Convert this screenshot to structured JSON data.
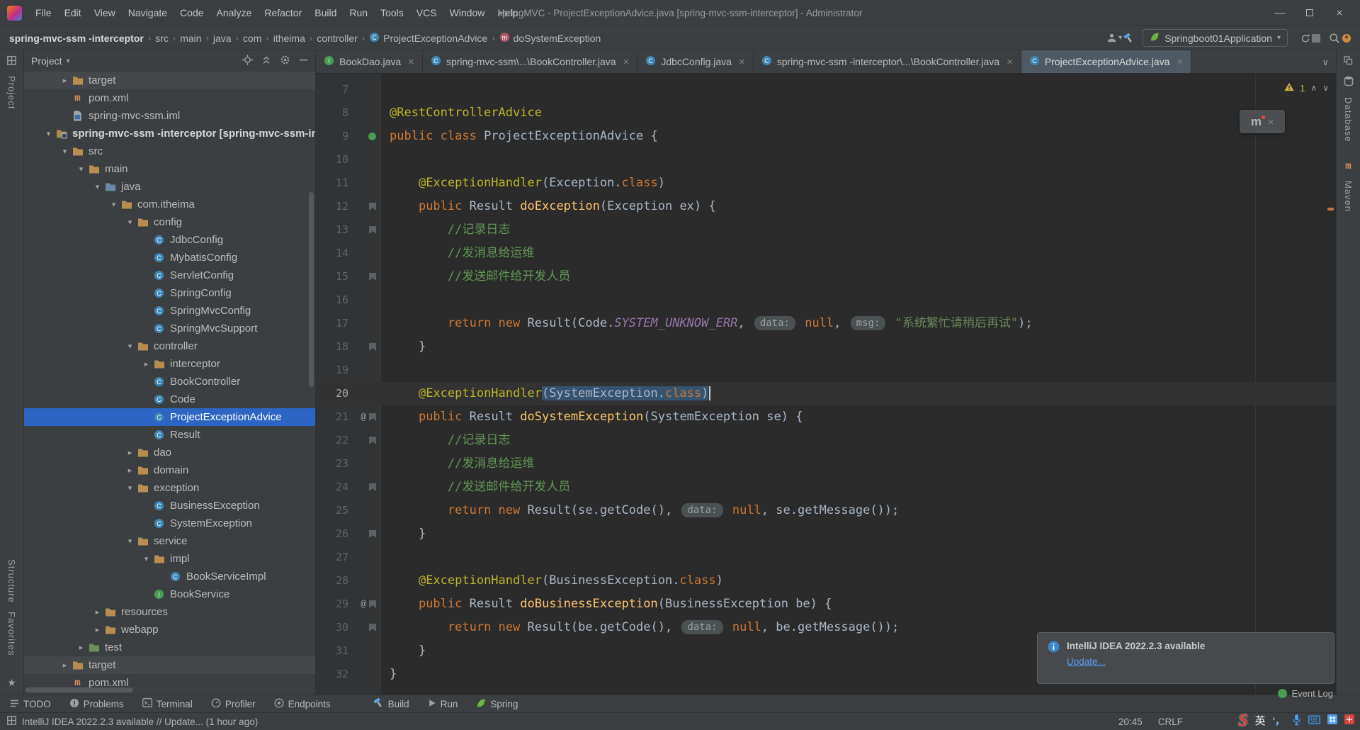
{
  "window": {
    "title": "springMVC - ProjectExceptionAdvice.java [spring-mvc-ssm-interceptor] - Administrator",
    "menus": [
      "File",
      "Edit",
      "View",
      "Navigate",
      "Code",
      "Analyze",
      "Refactor",
      "Build",
      "Run",
      "Tools",
      "VCS",
      "Window",
      "Help"
    ],
    "controls": {
      "minimize": "—",
      "close": "×"
    }
  },
  "navbar": {
    "breadcrumbs": [
      {
        "label": "spring-mvc-ssm -interceptor"
      },
      {
        "label": "src"
      },
      {
        "label": "main"
      },
      {
        "label": "java"
      },
      {
        "label": "com"
      },
      {
        "label": "itheima"
      },
      {
        "label": "controller"
      },
      {
        "label": "ProjectExceptionAdvice",
        "icon": "class"
      },
      {
        "label": "doSystemException",
        "icon": "method"
      }
    ],
    "right": {
      "icons_before": [
        "collaborate",
        "hammer"
      ],
      "run_config": "Springboot01Application",
      "icons_after": [
        "run",
        "debug",
        "coverage",
        "restart",
        "stop"
      ],
      "icons_tail": [
        "search",
        "update"
      ]
    }
  },
  "left_stripe": {
    "top": [
      "Project"
    ],
    "bottom": [
      "Structure",
      "Favorites"
    ]
  },
  "right_stripe": {
    "items": [
      "Database",
      "Maven"
    ]
  },
  "project_panel": {
    "title": "Project",
    "header_icons": [
      "locate",
      "collapse",
      "gear",
      "minus"
    ],
    "tree": [
      {
        "l": "target",
        "d": 1,
        "i": "folder",
        "a": "c",
        "band": true
      },
      {
        "l": "pom.xml",
        "d": 1,
        "i": "mvn"
      },
      {
        "l": "spring-mvc-ssm.iml",
        "d": 1,
        "i": "iml"
      },
      {
        "l": "spring-mvc-ssm -interceptor [spring-mvc-ssm-int...",
        "d": 0,
        "i": "mod",
        "a": "e",
        "bold": true
      },
      {
        "l": "src",
        "d": 1,
        "i": "folder",
        "a": "e"
      },
      {
        "l": "main",
        "d": 2,
        "i": "folder",
        "a": "e"
      },
      {
        "l": "java",
        "d": 3,
        "i": "folderBlue",
        "a": "e"
      },
      {
        "l": "com.itheima",
        "d": 4,
        "i": "pkg",
        "a": "e"
      },
      {
        "l": "config",
        "d": 5,
        "i": "pkg",
        "a": "e"
      },
      {
        "l": "JdbcConfig",
        "d": 6,
        "i": "cls"
      },
      {
        "l": "MybatisConfig",
        "d": 6,
        "i": "cls"
      },
      {
        "l": "ServletConfig",
        "d": 6,
        "i": "cls"
      },
      {
        "l": "SpringConfig",
        "d": 6,
        "i": "cls"
      },
      {
        "l": "SpringMvcConfig",
        "d": 6,
        "i": "cls"
      },
      {
        "l": "SpringMvcSupport",
        "d": 6,
        "i": "cls"
      },
      {
        "l": "controller",
        "d": 5,
        "i": "pkg",
        "a": "e"
      },
      {
        "l": "interceptor",
        "d": 6,
        "i": "pkg",
        "a": "c"
      },
      {
        "l": "BookController",
        "d": 6,
        "i": "cls"
      },
      {
        "l": "Code",
        "d": 6,
        "i": "cls"
      },
      {
        "l": "ProjectExceptionAdvice",
        "d": 6,
        "i": "cls",
        "sel": true
      },
      {
        "l": "Result",
        "d": 6,
        "i": "cls"
      },
      {
        "l": "dao",
        "d": 5,
        "i": "pkg",
        "a": "c"
      },
      {
        "l": "domain",
        "d": 5,
        "i": "pkg",
        "a": "c"
      },
      {
        "l": "exception",
        "d": 5,
        "i": "pkg",
        "a": "e"
      },
      {
        "l": "BusinessException",
        "d": 6,
        "i": "cls"
      },
      {
        "l": "SystemException",
        "d": 6,
        "i": "cls"
      },
      {
        "l": "service",
        "d": 5,
        "i": "pkg",
        "a": "e"
      },
      {
        "l": "impl",
        "d": 6,
        "i": "pkg",
        "a": "e"
      },
      {
        "l": "BookServiceImpl",
        "d": 7,
        "i": "cls"
      },
      {
        "l": "BookService",
        "d": 6,
        "i": "itf"
      },
      {
        "l": "resources",
        "d": 3,
        "i": "folder",
        "a": "c"
      },
      {
        "l": "webapp",
        "d": 3,
        "i": "folder",
        "a": "c"
      },
      {
        "l": "test",
        "d": 2,
        "i": "folderGreen",
        "a": "c"
      },
      {
        "l": "target",
        "d": 1,
        "i": "folder",
        "a": "c",
        "band": true
      },
      {
        "l": "pom.xml",
        "d": 1,
        "i": "mvn"
      }
    ]
  },
  "editor": {
    "tabs": [
      {
        "label": "BookDao.java",
        "icon": "itf"
      },
      {
        "label": "spring-mvc-ssm\\...\\BookController.java",
        "icon": "cls"
      },
      {
        "label": "JdbcConfig.java",
        "icon": "cls"
      },
      {
        "label": "spring-mvc-ssm -interceptor\\...\\BookController.java",
        "icon": "cls"
      },
      {
        "label": "ProjectExceptionAdvice.java",
        "icon": "cls",
        "active": true
      }
    ],
    "inspection": {
      "warning_count": "1"
    },
    "floating_widget": {
      "label": "m"
    },
    "lines": [
      {
        "n": 7,
        "seg": []
      },
      {
        "n": 8,
        "seg": [
          [
            "a",
            "@RestControllerAdvice"
          ]
        ]
      },
      {
        "n": 9,
        "g": "class",
        "seg": [
          [
            "k",
            "public class "
          ],
          [
            "d",
            "ProjectExceptionAdvice {"
          ]
        ]
      },
      {
        "n": 10,
        "seg": []
      },
      {
        "n": 11,
        "seg": [
          [
            "d",
            "    "
          ],
          [
            "a",
            "@ExceptionHandler"
          ],
          [
            "d",
            "(Exception."
          ],
          [
            "k",
            "class"
          ],
          [
            "d",
            ")"
          ]
        ]
      },
      {
        "n": 12,
        "g": "b",
        "seg": [
          [
            "d",
            "    "
          ],
          [
            "k",
            "public "
          ],
          [
            "d",
            "Result "
          ],
          [
            "m",
            "doException"
          ],
          [
            "d",
            "(Exception ex) {"
          ]
        ]
      },
      {
        "n": 13,
        "g": "b",
        "seg": [
          [
            "d",
            "        "
          ],
          [
            "c",
            "//记录日志"
          ]
        ]
      },
      {
        "n": 14,
        "seg": [
          [
            "d",
            "        "
          ],
          [
            "c",
            "//发消息给运维"
          ]
        ]
      },
      {
        "n": 15,
        "g": "b",
        "seg": [
          [
            "d",
            "        "
          ],
          [
            "c",
            "//发送邮件给开发人员"
          ]
        ]
      },
      {
        "n": 16,
        "seg": []
      },
      {
        "n": 17,
        "seg": [
          [
            "d",
            "        "
          ],
          [
            "k",
            "return "
          ],
          [
            "k",
            "new "
          ],
          [
            "d",
            "Result(Code."
          ],
          [
            "p",
            "SYSTEM_UNKNOW_ERR"
          ],
          [
            "d",
            ", "
          ],
          [
            "h",
            "data:"
          ],
          [
            "d",
            " "
          ],
          [
            "k",
            "null"
          ],
          [
            "d",
            ", "
          ],
          [
            "h",
            "msg:"
          ],
          [
            "d",
            " "
          ],
          [
            "s",
            "\"系统繁忙请稍后再试\""
          ],
          [
            "d",
            ");"
          ]
        ]
      },
      {
        "n": 18,
        "g": "b",
        "seg": [
          [
            "d",
            "    }"
          ]
        ]
      },
      {
        "n": 19,
        "seg": []
      },
      {
        "n": 20,
        "cur": true,
        "caret": true,
        "seg": [
          [
            "d",
            "    "
          ],
          [
            "a",
            "@ExceptionHandler"
          ],
          [
            "d!",
            "(SystemException."
          ],
          [
            "k!",
            "class"
          ],
          [
            "d!",
            ")"
          ]
        ]
      },
      {
        "n": 21,
        "g": "@b",
        "seg": [
          [
            "d",
            "    "
          ],
          [
            "k",
            "public "
          ],
          [
            "d",
            "Result "
          ],
          [
            "m",
            "doSystemException"
          ],
          [
            "d",
            "(SystemException se) {"
          ]
        ]
      },
      {
        "n": 22,
        "g": "b",
        "seg": [
          [
            "d",
            "        "
          ],
          [
            "c",
            "//记录日志"
          ]
        ]
      },
      {
        "n": 23,
        "seg": [
          [
            "d",
            "        "
          ],
          [
            "c",
            "//发消息给运维"
          ]
        ]
      },
      {
        "n": 24,
        "g": "b",
        "seg": [
          [
            "d",
            "        "
          ],
          [
            "c",
            "//发送邮件给开发人员"
          ]
        ]
      },
      {
        "n": 25,
        "seg": [
          [
            "d",
            "        "
          ],
          [
            "k",
            "return "
          ],
          [
            "k",
            "new "
          ],
          [
            "d",
            "Result(se.getCode(), "
          ],
          [
            "h",
            "data:"
          ],
          [
            "d",
            " "
          ],
          [
            "k",
            "null"
          ],
          [
            "d",
            ", se.getMessage());"
          ]
        ]
      },
      {
        "n": 26,
        "g": "b",
        "seg": [
          [
            "d",
            "    }"
          ]
        ]
      },
      {
        "n": 27,
        "seg": []
      },
      {
        "n": 28,
        "seg": [
          [
            "d",
            "    "
          ],
          [
            "a",
            "@ExceptionHandler"
          ],
          [
            "d",
            "(BusinessException."
          ],
          [
            "k",
            "class"
          ],
          [
            "d",
            ")"
          ]
        ]
      },
      {
        "n": 29,
        "g": "@b",
        "seg": [
          [
            "d",
            "    "
          ],
          [
            "k",
            "public "
          ],
          [
            "d",
            "Result "
          ],
          [
            "m",
            "doBusinessException"
          ],
          [
            "d",
            "(BusinessException be) {"
          ]
        ]
      },
      {
        "n": 30,
        "g": "b",
        "seg": [
          [
            "d",
            "        "
          ],
          [
            "k",
            "return "
          ],
          [
            "k",
            "new "
          ],
          [
            "d",
            "Result(be.getCode(), "
          ],
          [
            "h",
            "data:"
          ],
          [
            "d",
            " "
          ],
          [
            "k",
            "null"
          ],
          [
            "d",
            ", be.getMessage());"
          ]
        ]
      },
      {
        "n": 31,
        "seg": [
          [
            "d",
            "    }"
          ]
        ]
      },
      {
        "n": 32,
        "seg": [
          [
            "d",
            "}"
          ]
        ]
      }
    ]
  },
  "bottom_bar": {
    "items": [
      {
        "label": "TODO",
        "icon": "lines"
      },
      {
        "label": "Problems",
        "icon": "excl"
      },
      {
        "label": "Terminal",
        "icon": "term"
      },
      {
        "label": "Profiler",
        "icon": "gauge"
      },
      {
        "label": "Endpoints",
        "icon": "plug"
      },
      {
        "label": "Build",
        "icon": "hammer"
      },
      {
        "label": "Run",
        "icon": "playgray"
      },
      {
        "label": "Spring",
        "icon": "leaf"
      }
    ]
  },
  "status_bar": {
    "message": "IntelliJ IDEA 2022.2.3 available // Update... (1 hour ago)",
    "time": "20:45",
    "line_ending": "CRLF"
  },
  "notification": {
    "title": "IntelliJ IDEA 2022.2.3 available",
    "link": "Update...",
    "event_log": "Event Log"
  },
  "ime": {
    "logo": "S",
    "lang": "英",
    "punct": "'，"
  }
}
